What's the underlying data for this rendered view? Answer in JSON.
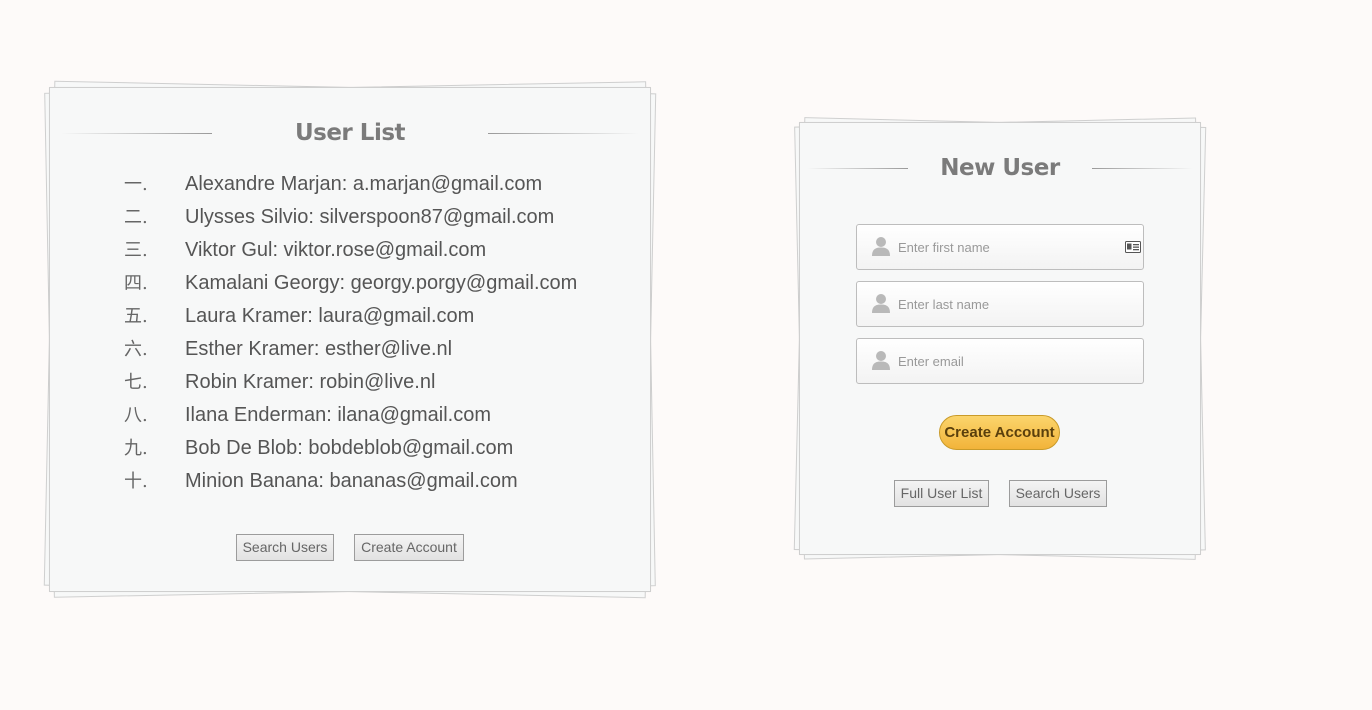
{
  "user_list_panel": {
    "title": "User List",
    "users": [
      {
        "num": "一.",
        "text": "Alexandre Marjan: a.marjan@gmail.com"
      },
      {
        "num": "二.",
        "text": "Ulysses Silvio: silverspoon87@gmail.com"
      },
      {
        "num": "三.",
        "text": "Viktor Gul: viktor.rose@gmail.com"
      },
      {
        "num": "四.",
        "text": "Kamalani Georgy: georgy.porgy@gmail.com"
      },
      {
        "num": "五.",
        "text": "Laura Kramer: laura@gmail.com"
      },
      {
        "num": "六.",
        "text": "Esther Kramer: esther@live.nl"
      },
      {
        "num": "七.",
        "text": "Robin Kramer: robin@live.nl"
      },
      {
        "num": "八.",
        "text": "Ilana Enderman: ilana@gmail.com"
      },
      {
        "num": "九.",
        "text": "Bob De Blob: bobdeblob@gmail.com"
      },
      {
        "num": "十.",
        "text": "Minion Banana: bananas@gmail.com"
      }
    ],
    "search_users_label": "Search Users",
    "create_account_label": "Create Account"
  },
  "new_user_panel": {
    "title": "New User",
    "first_name_placeholder": "Enter first name",
    "last_name_placeholder": "Enter last name",
    "email_placeholder": "Enter email",
    "create_account_label": "Create Account",
    "full_user_list_label": "Full User List",
    "search_users_label": "Search Users"
  },
  "icons": {
    "field_user": "user-icon",
    "field_card": "id-card-icon"
  },
  "colors": {
    "background": "#fdfaf9",
    "panel": "#f7f8f8",
    "title": "#7b7b7b",
    "primary_button": "#f2b43a"
  }
}
